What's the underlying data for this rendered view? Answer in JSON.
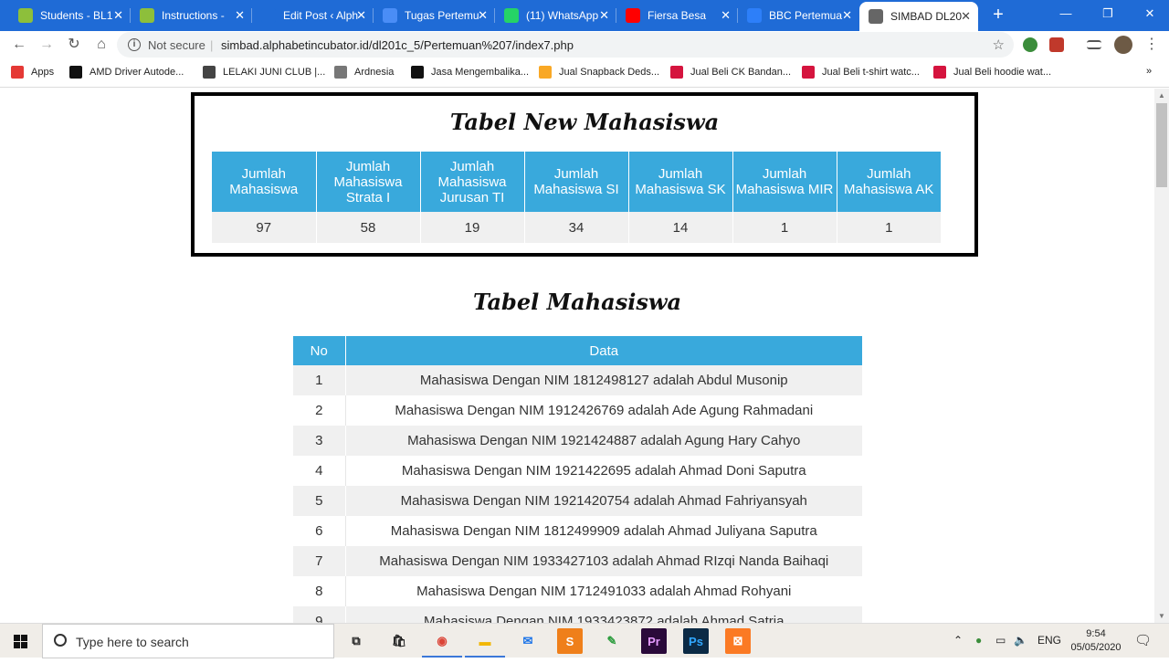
{
  "browser": {
    "tabs": [
      {
        "title": "Students - BL1",
        "color": "#8dbf3b"
      },
      {
        "title": "Instructions -",
        "color": "#8dbf3b"
      },
      {
        "title": "Edit Post ‹ Alph",
        "color": "#1f6bd6"
      },
      {
        "title": "Tugas Pertemu",
        "color": "#4a8df6"
      },
      {
        "title": "(11) WhatsApp",
        "color": "#25d366"
      },
      {
        "title": "Fiersa Besa",
        "color": "#ff0000"
      },
      {
        "title": "BBC Pertemua",
        "color": "#2d7ff9"
      },
      {
        "title": "SIMBAD DL20",
        "color": "#666666"
      }
    ],
    "new_tab_symbol": "+",
    "address": {
      "security_label": "Not secure",
      "separator": "|",
      "url": "simbad.alphabetincubator.id/dl201c_5/Pertemuan%207/index7.php"
    },
    "bookmarks": [
      {
        "label": "Apps",
        "color": "#e53935"
      },
      {
        "label": "AMD Driver Autode...",
        "color": "#111111"
      },
      {
        "label": "LELAKI JUNI CLUB |...",
        "color": "#444444"
      },
      {
        "label": "Ardnesia",
        "color": "#777777"
      },
      {
        "label": "Jasa Mengembalika...",
        "color": "#111111"
      },
      {
        "label": "Jual Snapback Deds...",
        "color": "#f9a825"
      },
      {
        "label": "Jual Beli CK Bandan...",
        "color": "#d5143e"
      },
      {
        "label": "Jual Beli t-shirt watc...",
        "color": "#d5143e"
      },
      {
        "label": "Jual Beli hoodie wat...",
        "color": "#d5143e"
      }
    ],
    "more_bookmarks_symbol": "»"
  },
  "page": {
    "new_title": "Tabel New Mahasiswa",
    "new_headers": [
      "Jumlah Mahasiswa",
      "Jumlah Mahasiswa Strata I",
      "Jumlah Mahasiswa Jurusan TI",
      "Jumlah Mahasiswa SI",
      "Jumlah Mahasiswa SK",
      "Jumlah Mahasiswa MIR",
      "Jumlah Mahasiswa AK"
    ],
    "new_values": [
      "97",
      "58",
      "19",
      "34",
      "14",
      "1",
      "1"
    ],
    "mhs_title": "Tabel Mahasiswa",
    "mhs_headers": {
      "no": "No",
      "data": "Data"
    },
    "mhs_rows": [
      {
        "no": "1",
        "data": "Mahasiswa Dengan NIM 1812498127 adalah Abdul Musonip"
      },
      {
        "no": "2",
        "data": "Mahasiswa Dengan NIM 1912426769 adalah Ade Agung Rahmadani"
      },
      {
        "no": "3",
        "data": "Mahasiswa Dengan NIM 1921424887 adalah Agung Hary Cahyo"
      },
      {
        "no": "4",
        "data": "Mahasiswa Dengan NIM 1921422695 adalah Ahmad Doni Saputra"
      },
      {
        "no": "5",
        "data": "Mahasiswa Dengan NIM 1921420754 adalah Ahmad Fahriyansyah"
      },
      {
        "no": "6",
        "data": "Mahasiswa Dengan NIM 1812499909 adalah Ahmad Juliyana Saputra"
      },
      {
        "no": "7",
        "data": "Mahasiswa Dengan NIM 1933427103 adalah Ahmad RIzqi Nanda Baihaqi"
      },
      {
        "no": "8",
        "data": "Mahasiswa Dengan NIM 1712491033 adalah Ahmad Rohyani"
      },
      {
        "no": "9",
        "data": "Mahasiswa Dengan NIM 1933423872 adalah Ahmad Satria"
      }
    ]
  },
  "taskbar": {
    "search_placeholder": "Type here to search",
    "language": "ENG",
    "time": "9:54",
    "date": "05/05/2020",
    "apps": [
      {
        "name": "task-view",
        "label": "⧉",
        "color": "#f0ede8",
        "text": "#222"
      },
      {
        "name": "store",
        "label": "🛍",
        "color": "#f0ede8",
        "text": "#222"
      },
      {
        "name": "chrome",
        "label": "◉",
        "color": "#f0ede8",
        "text": "#db4437"
      },
      {
        "name": "file-explorer",
        "label": "▬",
        "color": "#f0ede8",
        "text": "#f2b705"
      },
      {
        "name": "mail",
        "label": "✉",
        "color": "#f0ede8",
        "text": "#1a73e8"
      },
      {
        "name": "sublime",
        "label": "S",
        "color": "#ef7f1a",
        "text": "#fff"
      },
      {
        "name": "corel",
        "label": "✎",
        "color": "#f0ede8",
        "text": "#2e9d3f"
      },
      {
        "name": "premiere",
        "label": "Pr",
        "color": "#2a0a3a",
        "text": "#e59bff"
      },
      {
        "name": "photoshop",
        "label": "Ps",
        "color": "#0b2a45",
        "text": "#31a8ff"
      },
      {
        "name": "xampp",
        "label": "⊠",
        "color": "#fb7a24",
        "text": "#fff"
      }
    ]
  }
}
